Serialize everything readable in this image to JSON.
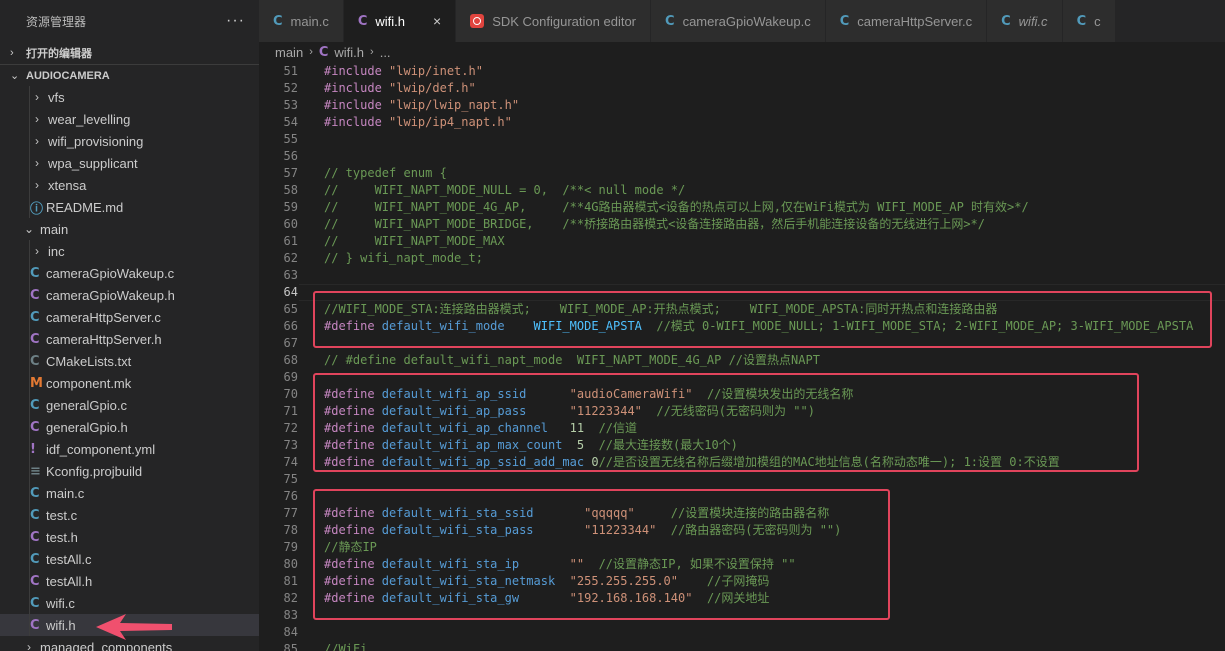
{
  "sidebar": {
    "title": "资源管理器",
    "more": "···",
    "open_editors_label": "打开的编辑器",
    "project_label": "AUDIOCAMERA",
    "items": [
      {
        "label": "vfs",
        "kind": "folder-closed",
        "depth": 1
      },
      {
        "label": "wear_levelling",
        "kind": "folder-closed",
        "depth": 1
      },
      {
        "label": "wifi_provisioning",
        "kind": "folder-closed",
        "depth": 1
      },
      {
        "label": "wpa_supplicant",
        "kind": "folder-closed",
        "depth": 1
      },
      {
        "label": "xtensa",
        "kind": "folder-closed",
        "depth": 1
      },
      {
        "label": "README.md",
        "kind": "file-md",
        "depth": 1
      },
      {
        "label": "main",
        "kind": "folder-open",
        "depth": 0
      },
      {
        "label": "inc",
        "kind": "folder-closed",
        "depth": 1
      },
      {
        "label": "cameraGpioWakeup.c",
        "kind": "file-c",
        "depth": 1
      },
      {
        "label": "cameraGpioWakeup.h",
        "kind": "file-h",
        "depth": 1
      },
      {
        "label": "cameraHttpServer.c",
        "kind": "file-c",
        "depth": 1
      },
      {
        "label": "cameraHttpServer.h",
        "kind": "file-h",
        "depth": 1
      },
      {
        "label": "CMakeLists.txt",
        "kind": "file-cmake",
        "depth": 1
      },
      {
        "label": "component.mk",
        "kind": "file-mk",
        "depth": 1
      },
      {
        "label": "generalGpio.c",
        "kind": "file-c",
        "depth": 1
      },
      {
        "label": "generalGpio.h",
        "kind": "file-h",
        "depth": 1
      },
      {
        "label": "idf_component.yml",
        "kind": "file-yml",
        "depth": 1
      },
      {
        "label": "Kconfig.projbuild",
        "kind": "file-plain",
        "depth": 1
      },
      {
        "label": "main.c",
        "kind": "file-c",
        "depth": 1
      },
      {
        "label": "test.c",
        "kind": "file-c",
        "depth": 1
      },
      {
        "label": "test.h",
        "kind": "file-h",
        "depth": 1
      },
      {
        "label": "testAll.c",
        "kind": "file-c",
        "depth": 1
      },
      {
        "label": "testAll.h",
        "kind": "file-h",
        "depth": 1
      },
      {
        "label": "wifi.c",
        "kind": "file-c",
        "depth": 1
      },
      {
        "label": "wifi.h",
        "kind": "file-h",
        "depth": 1,
        "selected": true
      },
      {
        "label": "managed_components",
        "kind": "folder-closed",
        "depth": 0
      }
    ]
  },
  "icons": {
    "c": "C",
    "h": "C",
    "md": "ⓘ",
    "cmake": "C",
    "mk": "M",
    "yml": "!",
    "plain": "≡",
    "chevron_right": "›",
    "chevron_down": "⌄"
  },
  "colors": {
    "c_icon": "#519aba",
    "h_icon": "#a074c4",
    "md_icon": "#519aba",
    "cmake_icon": "#6d8086",
    "mk_icon": "#e37933",
    "yml_icon": "#a074c4",
    "plain_icon": "#6d8086",
    "highlight_box": "#e0445c",
    "arrow": "#f0506e"
  },
  "tabs": [
    {
      "label": "main.c",
      "icon": "c-icon",
      "active": false
    },
    {
      "label": "wifi.h",
      "icon": "h-icon",
      "active": true,
      "close": "×"
    },
    {
      "label": "SDK Configuration editor",
      "icon": "sdk-icon",
      "active": false
    },
    {
      "label": "cameraGpioWakeup.c",
      "icon": "c-icon",
      "active": false
    },
    {
      "label": "cameraHttpServer.c",
      "icon": "c-icon",
      "active": false
    },
    {
      "label": "wifi.c",
      "icon": "c-icon",
      "active": false,
      "italic": true
    },
    {
      "label": "c",
      "icon": "c-icon",
      "active": false
    }
  ],
  "breadcrumb": {
    "folder": "main",
    "file": "wifi.h",
    "symbol": "..."
  },
  "code_lines": [
    {
      "n": "51",
      "tokens": [
        [
          "dir",
          "#include "
        ],
        [
          "str",
          "\"lwip/inet.h\""
        ]
      ]
    },
    {
      "n": "52",
      "tokens": [
        [
          "dir",
          "#include "
        ],
        [
          "str",
          "\"lwip/def.h\""
        ]
      ]
    },
    {
      "n": "53",
      "tokens": [
        [
          "dir",
          "#include "
        ],
        [
          "str",
          "\"lwip/lwip_napt.h\""
        ]
      ]
    },
    {
      "n": "54",
      "tokens": [
        [
          "dir",
          "#include "
        ],
        [
          "str",
          "\"lwip/ip4_napt.h\""
        ]
      ]
    },
    {
      "n": "55",
      "tokens": []
    },
    {
      "n": "56",
      "tokens": []
    },
    {
      "n": "57",
      "tokens": [
        [
          "com",
          "// typedef enum {"
        ]
      ]
    },
    {
      "n": "58",
      "tokens": [
        [
          "com",
          "//     WIFI_NAPT_MODE_NULL = 0,  /**< null mode */"
        ]
      ]
    },
    {
      "n": "59",
      "tokens": [
        [
          "com",
          "//     WIFI_NAPT_MODE_4G_AP,     /**4G路由器模式<设备的热点可以上网,仅在WiFi模式为 WIFI_MODE_AP 时有效>*/"
        ]
      ]
    },
    {
      "n": "60",
      "tokens": [
        [
          "com",
          "//     WIFI_NAPT_MODE_BRIDGE,    /**桥接路由器模式<设备连接路由器，然后手机能连接设备的无线进行上网>*/"
        ]
      ]
    },
    {
      "n": "61",
      "tokens": [
        [
          "com",
          "//     WIFI_NAPT_MODE_MAX"
        ]
      ]
    },
    {
      "n": "62",
      "tokens": [
        [
          "com",
          "// } wifi_napt_mode_t;"
        ]
      ]
    },
    {
      "n": "63",
      "tokens": []
    },
    {
      "n": "64",
      "tokens": [],
      "current": true
    },
    {
      "n": "65",
      "tokens": [
        [
          "com",
          "//WIFI_MODE_STA:连接路由器模式;    WIFI_MODE_AP:开热点模式;    WIFI_MODE_APSTA:同时开热点和连接路由器"
        ]
      ]
    },
    {
      "n": "66",
      "tokens": [
        [
          "dir",
          "#define "
        ],
        [
          "mac",
          "default_wifi_mode"
        ],
        [
          "pl",
          "    "
        ],
        [
          "kw",
          "WIFI_MODE_APSTA"
        ],
        [
          "pl",
          "  "
        ],
        [
          "com",
          "//模式 0-WIFI_MODE_NULL; 1-WIFI_MODE_STA; 2-WIFI_MODE_AP; 3-WIFI_MODE_APSTA"
        ]
      ]
    },
    {
      "n": "67",
      "tokens": []
    },
    {
      "n": "68",
      "tokens": [
        [
          "com",
          "// #define default_wifi_napt_mode  WIFI_NAPT_MODE_4G_AP //设置热点NAPT"
        ]
      ]
    },
    {
      "n": "69",
      "tokens": []
    },
    {
      "n": "70",
      "tokens": [
        [
          "dir",
          "#define "
        ],
        [
          "mac",
          "default_wifi_ap_ssid"
        ],
        [
          "pl",
          "      "
        ],
        [
          "str",
          "\"audioCameraWifi\""
        ],
        [
          "pl",
          "  "
        ],
        [
          "com",
          "//设置模块发出的无线名称"
        ]
      ]
    },
    {
      "n": "71",
      "tokens": [
        [
          "dir",
          "#define "
        ],
        [
          "mac",
          "default_wifi_ap_pass"
        ],
        [
          "pl",
          "      "
        ],
        [
          "str",
          "\"11223344\""
        ],
        [
          "pl",
          "  "
        ],
        [
          "com",
          "//无线密码(无密码则为 \"\")"
        ]
      ]
    },
    {
      "n": "72",
      "tokens": [
        [
          "dir",
          "#define "
        ],
        [
          "mac",
          "default_wifi_ap_channel"
        ],
        [
          "pl",
          "   "
        ],
        [
          "num",
          "11"
        ],
        [
          "pl",
          "  "
        ],
        [
          "com",
          "//信道"
        ]
      ]
    },
    {
      "n": "73",
      "tokens": [
        [
          "dir",
          "#define "
        ],
        [
          "mac",
          "default_wifi_ap_max_count"
        ],
        [
          "pl",
          "  "
        ],
        [
          "num",
          "5"
        ],
        [
          "pl",
          "  "
        ],
        [
          "com",
          "//最大连接数(最大10个)"
        ]
      ]
    },
    {
      "n": "74",
      "tokens": [
        [
          "dir",
          "#define "
        ],
        [
          "mac",
          "default_wifi_ap_ssid_add_mac"
        ],
        [
          "pl",
          " "
        ],
        [
          "num",
          "0"
        ],
        [
          "com",
          "//是否设置无线名称后缀增加模组的MAC地址信息(名称动态唯一); 1:设置 0:不设置"
        ]
      ]
    },
    {
      "n": "75",
      "tokens": []
    },
    {
      "n": "76",
      "tokens": []
    },
    {
      "n": "77",
      "tokens": [
        [
          "dir",
          "#define "
        ],
        [
          "mac",
          "default_wifi_sta_ssid"
        ],
        [
          "pl",
          "       "
        ],
        [
          "str",
          "\"qqqqq\""
        ],
        [
          "pl",
          "     "
        ],
        [
          "com",
          "//设置模块连接的路由器名称"
        ]
      ]
    },
    {
      "n": "78",
      "tokens": [
        [
          "dir",
          "#define "
        ],
        [
          "mac",
          "default_wifi_sta_pass"
        ],
        [
          "pl",
          "       "
        ],
        [
          "str",
          "\"11223344\""
        ],
        [
          "pl",
          "  "
        ],
        [
          "com",
          "//路由器密码(无密码则为 \"\")"
        ]
      ]
    },
    {
      "n": "79",
      "tokens": [
        [
          "com",
          "//静态IP"
        ]
      ]
    },
    {
      "n": "80",
      "tokens": [
        [
          "dir",
          "#define "
        ],
        [
          "mac",
          "default_wifi_sta_ip"
        ],
        [
          "pl",
          "       "
        ],
        [
          "str",
          "\"\""
        ],
        [
          "pl",
          "  "
        ],
        [
          "com",
          "//设置静态IP, 如果不设置保持 \"\""
        ]
      ]
    },
    {
      "n": "81",
      "tokens": [
        [
          "dir",
          "#define "
        ],
        [
          "mac",
          "default_wifi_sta_netmask"
        ],
        [
          "pl",
          "  "
        ],
        [
          "str",
          "\"255.255.255.0\""
        ],
        [
          "pl",
          "    "
        ],
        [
          "com",
          "//子网掩码"
        ]
      ]
    },
    {
      "n": "82",
      "tokens": [
        [
          "dir",
          "#define "
        ],
        [
          "mac",
          "default_wifi_sta_gw"
        ],
        [
          "pl",
          "       "
        ],
        [
          "str",
          "\"192.168.168.140\""
        ],
        [
          "pl",
          "  "
        ],
        [
          "com",
          "//网关地址"
        ]
      ]
    },
    {
      "n": "83",
      "tokens": []
    },
    {
      "n": "84",
      "tokens": []
    },
    {
      "n": "85",
      "tokens": [
        [
          "com",
          "//WiFi"
        ]
      ]
    }
  ]
}
